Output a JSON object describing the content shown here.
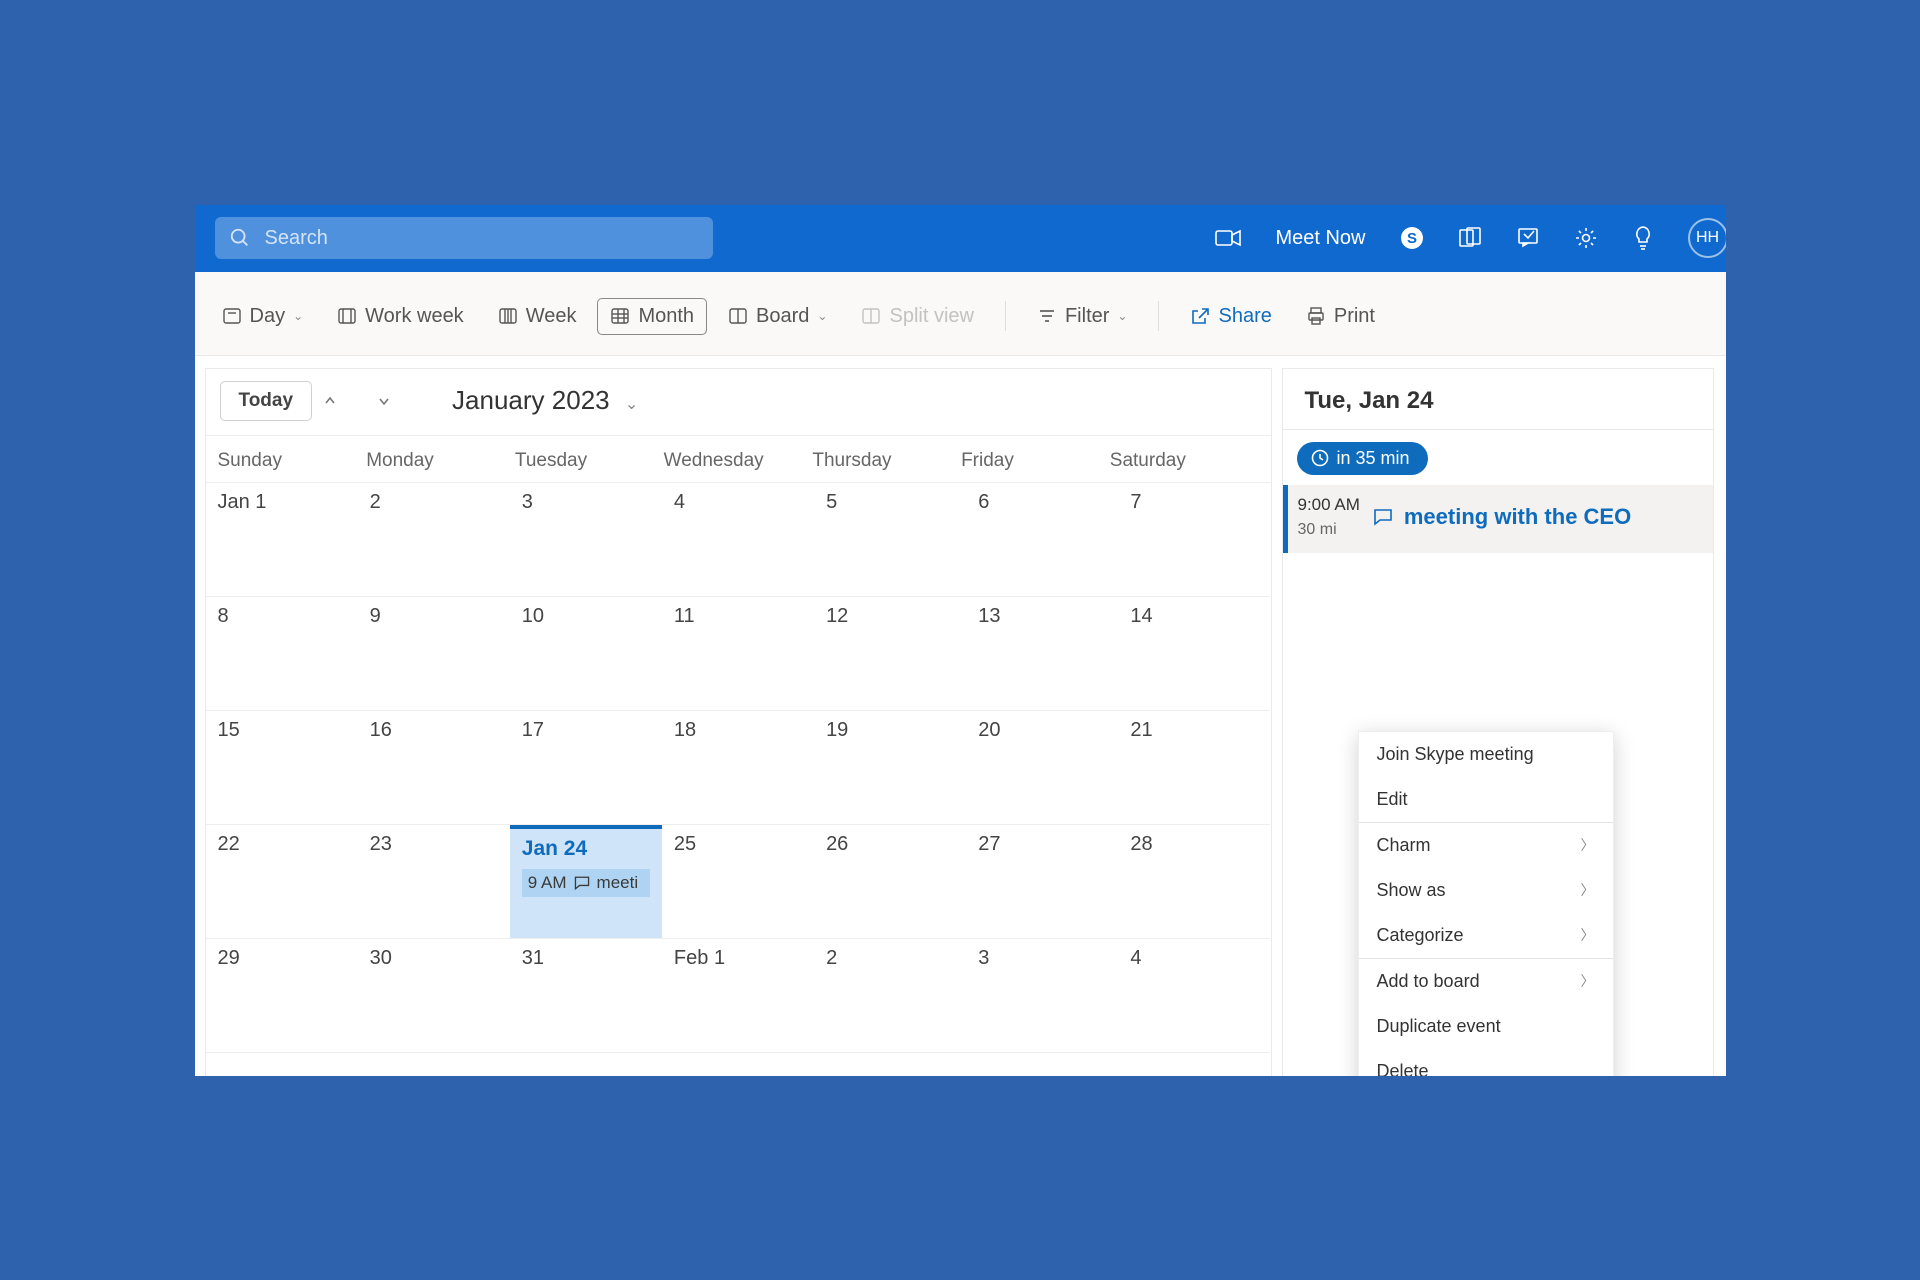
{
  "search": {
    "placeholder": "Search"
  },
  "ribbon": {
    "meet_now": "Meet Now",
    "avatar_initials": "HH"
  },
  "views": {
    "day": "Day",
    "workweek": "Work week",
    "week": "Week",
    "month": "Month",
    "board": "Board",
    "split": "Split view",
    "filter": "Filter",
    "share": "Share",
    "print": "Print"
  },
  "nav": {
    "today": "Today",
    "month_year": "January 2023"
  },
  "weekdays": [
    "Sunday",
    "Monday",
    "Tuesday",
    "Wednesday",
    "Thursday",
    "Friday",
    "Saturday"
  ],
  "cells": [
    [
      "Jan 1",
      "2",
      "3",
      "4",
      "5",
      "6",
      "7"
    ],
    [
      "8",
      "9",
      "10",
      "11",
      "12",
      "13",
      "14"
    ],
    [
      "15",
      "16",
      "17",
      "18",
      "19",
      "20",
      "21"
    ],
    [
      "22",
      "23",
      "Jan 24",
      "25",
      "26",
      "27",
      "28"
    ],
    [
      "29",
      "30",
      "31",
      "Feb 1",
      "2",
      "3",
      "4"
    ]
  ],
  "selected": {
    "row": 3,
    "col": 2
  },
  "cell_event": {
    "time": "9 AM",
    "title": "meeti"
  },
  "agenda": {
    "heading": "Tue, Jan 24",
    "pill": "in 35 min",
    "item": {
      "time": "9:00 AM",
      "duration": "30 mi",
      "title": "meeting with the CEO"
    }
  },
  "ctxmenu": {
    "join": "Join Skype meeting",
    "edit": "Edit",
    "charm": "Charm",
    "showas": "Show as",
    "categorize": "Categorize",
    "addboard": "Add to board",
    "dup": "Duplicate event",
    "del": "Delete"
  }
}
